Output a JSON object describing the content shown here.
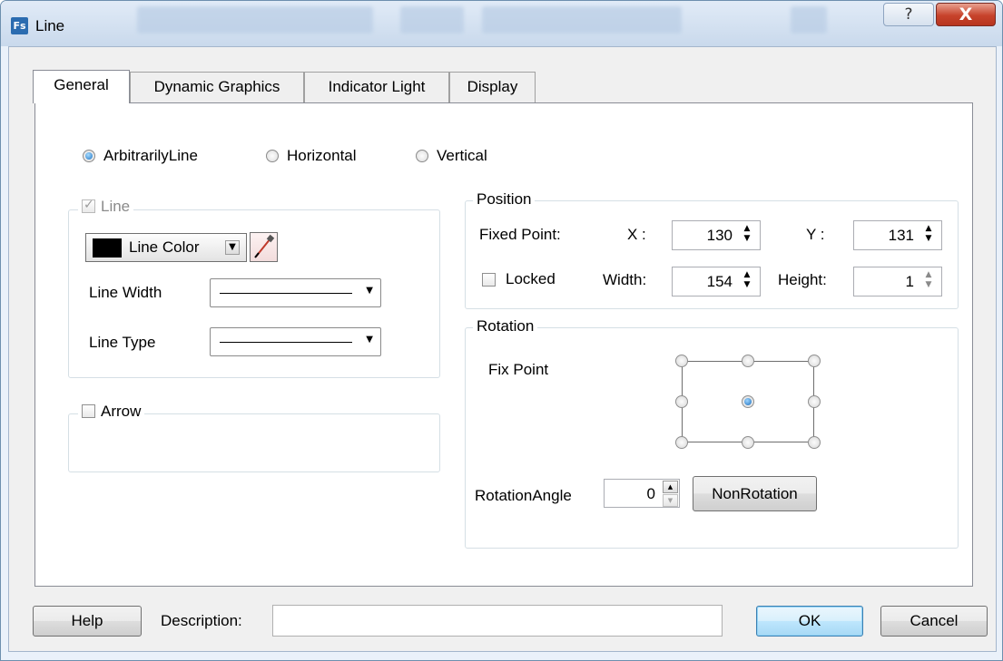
{
  "window": {
    "title": "Line",
    "app_icon_label": "Fs",
    "help_glyph": "?",
    "close_glyph": "X"
  },
  "tabs": [
    {
      "label": "General",
      "active": true
    },
    {
      "label": "Dynamic Graphics",
      "active": false
    },
    {
      "label": "Indicator Light",
      "active": false
    },
    {
      "label": "Display",
      "active": false
    }
  ],
  "line_mode": {
    "options": [
      "ArbitrarilyLine",
      "Horizontal",
      "Vertical"
    ],
    "selected": "ArbitrarilyLine"
  },
  "line_group": {
    "label": "Line",
    "checked": true,
    "enabled": false,
    "color_label": "Line Color",
    "line_color": "#000000",
    "width_label": "Line Width",
    "type_label": "Line Type"
  },
  "arrow_group": {
    "label": "Arrow",
    "checked": false
  },
  "position": {
    "title": "Position",
    "fixed_point_label": "Fixed Point:",
    "x_label": "X :",
    "x_value": "130",
    "y_label": "Y :",
    "y_value": "131",
    "locked_label": "Locked",
    "locked": false,
    "width_label": "Width:",
    "width_value": "154",
    "height_label": "Height:",
    "height_value": "1"
  },
  "rotation": {
    "title": "Rotation",
    "fix_point_label": "Fix Point",
    "selected_point": "center",
    "angle_label": "RotationAngle",
    "angle_value": "0",
    "nonrotation_label": "NonRotation"
  },
  "footer": {
    "help_label": "Help",
    "description_label": "Description:",
    "description_value": "",
    "ok_label": "OK",
    "cancel_label": "Cancel"
  },
  "colors": {
    "title_bar": "#c9d9ec",
    "close_button": "#c7432b",
    "radio_selected": "#1d74c4"
  }
}
